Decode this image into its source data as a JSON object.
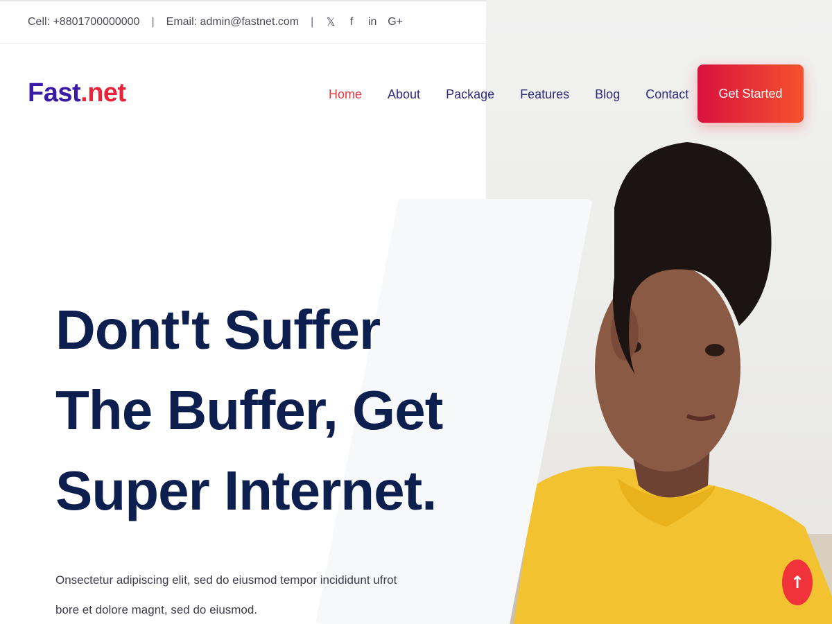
{
  "topbar": {
    "cell": "Cell: +8801700000000",
    "separator": "|",
    "email": "Email: admin@fastnet.com",
    "social": [
      {
        "icon": "twitter-icon",
        "glyph": "🐦"
      },
      {
        "icon": "facebook-icon",
        "glyph": "f"
      },
      {
        "icon": "linkedin-icon",
        "glyph": "in"
      },
      {
        "icon": "google-plus-icon",
        "glyph": "G+"
      }
    ]
  },
  "brand": {
    "part1": "Fast",
    "part2": ".net"
  },
  "nav": {
    "items": [
      "Home",
      "About",
      "Package",
      "Features",
      "Blog",
      "Contact"
    ],
    "active": "Home"
  },
  "cta": {
    "label": "Get Started"
  },
  "hero": {
    "headline": "Dont't Suffer The Buffer, Get Super Internet.",
    "subtext": "Onsectetur adipiscing elit, sed do eiusmod tempor incididunt ufrot bore et dolore magnt, sed do eiusmod."
  },
  "scroll_top": {
    "icon": "arrow-up-icon",
    "glyph": "↑"
  },
  "colors": {
    "brand_blue": "#3a1ba8",
    "brand_red": "#e8243a",
    "headline": "#0d1f4f",
    "nav": "#2d2a7a",
    "nav_active": "#e8363f",
    "cta_gradient": [
      "#d9113f",
      "#f5522e"
    ]
  }
}
